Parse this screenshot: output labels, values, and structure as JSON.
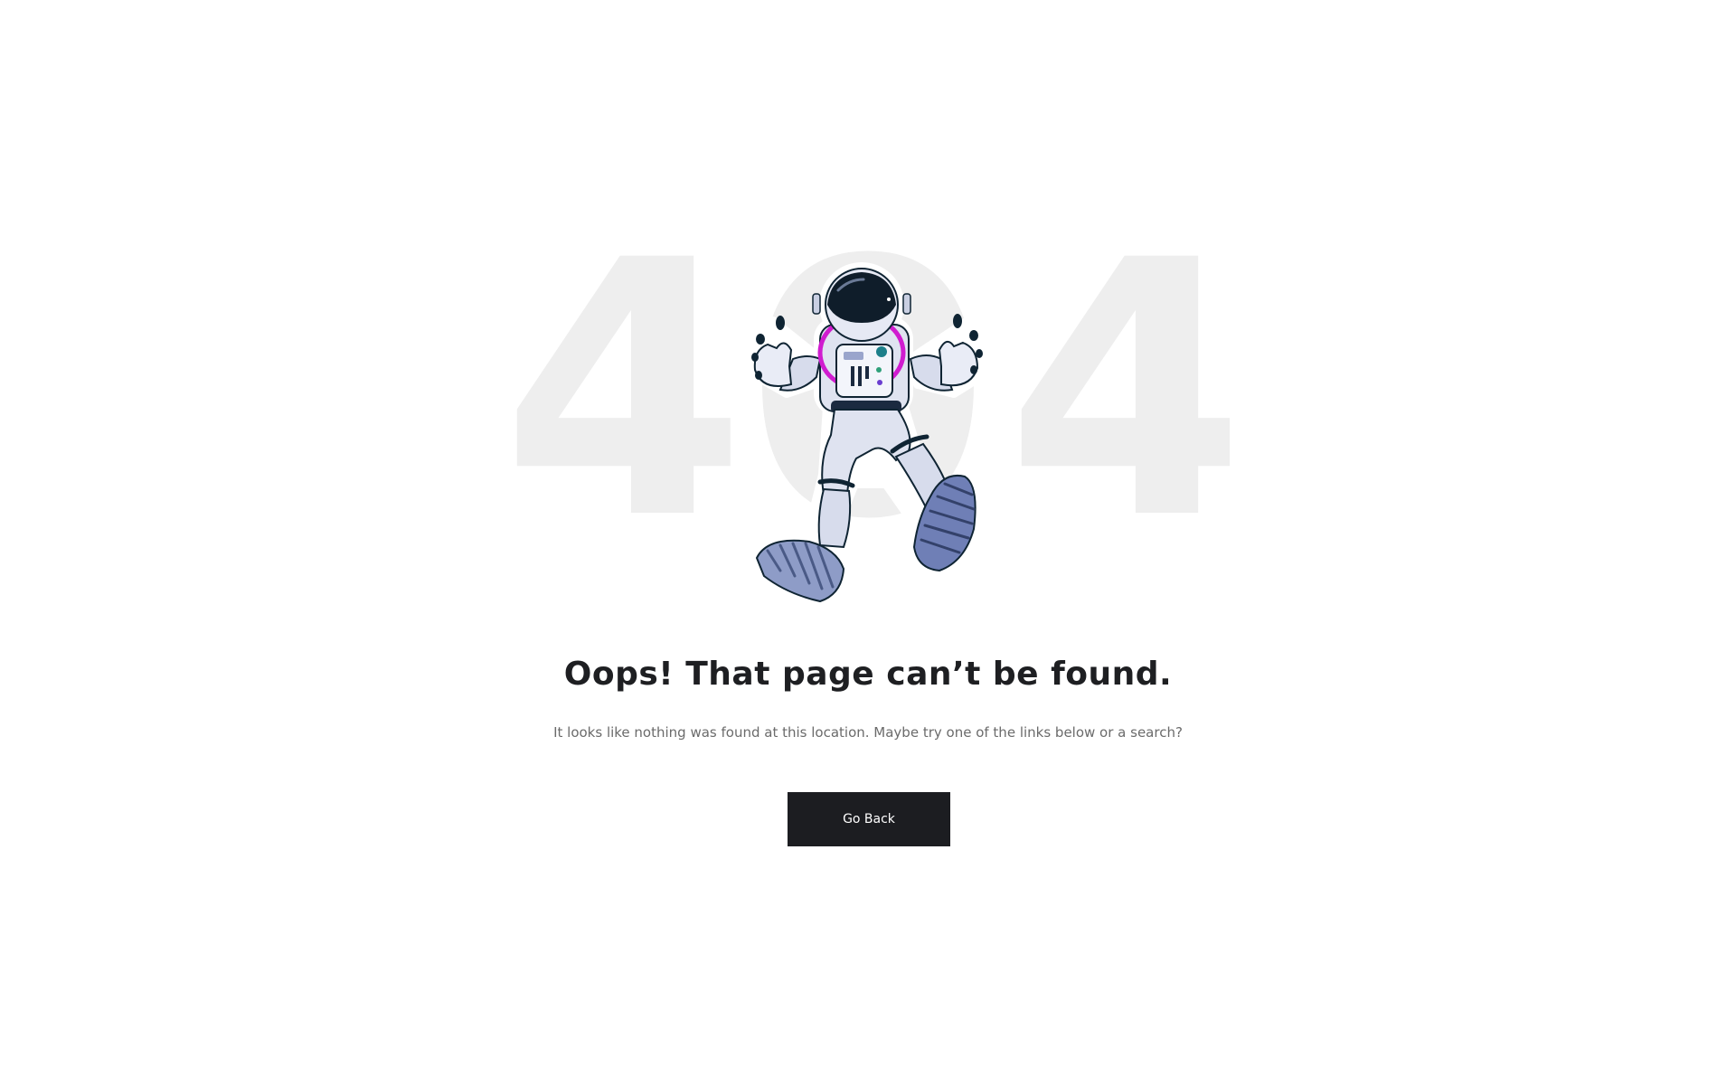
{
  "hero": {
    "code_left": "4",
    "code_middle": "0",
    "code_right": "4"
  },
  "error": {
    "title": "Oops! That page can’t be found.",
    "message": "It looks like nothing was found at this location. Maybe try one of the links below or a search?"
  },
  "actions": {
    "go_back_label": "Go Back"
  },
  "colors": {
    "background": "#ffffff",
    "big_code": "#eeeeee",
    "title": "#1e1f22",
    "message": "#6b6b6b",
    "button_bg": "#1c1d21",
    "button_text": "#ffffff",
    "accent_ring": "#d01ccf"
  },
  "illustration": "astronaut-floating"
}
